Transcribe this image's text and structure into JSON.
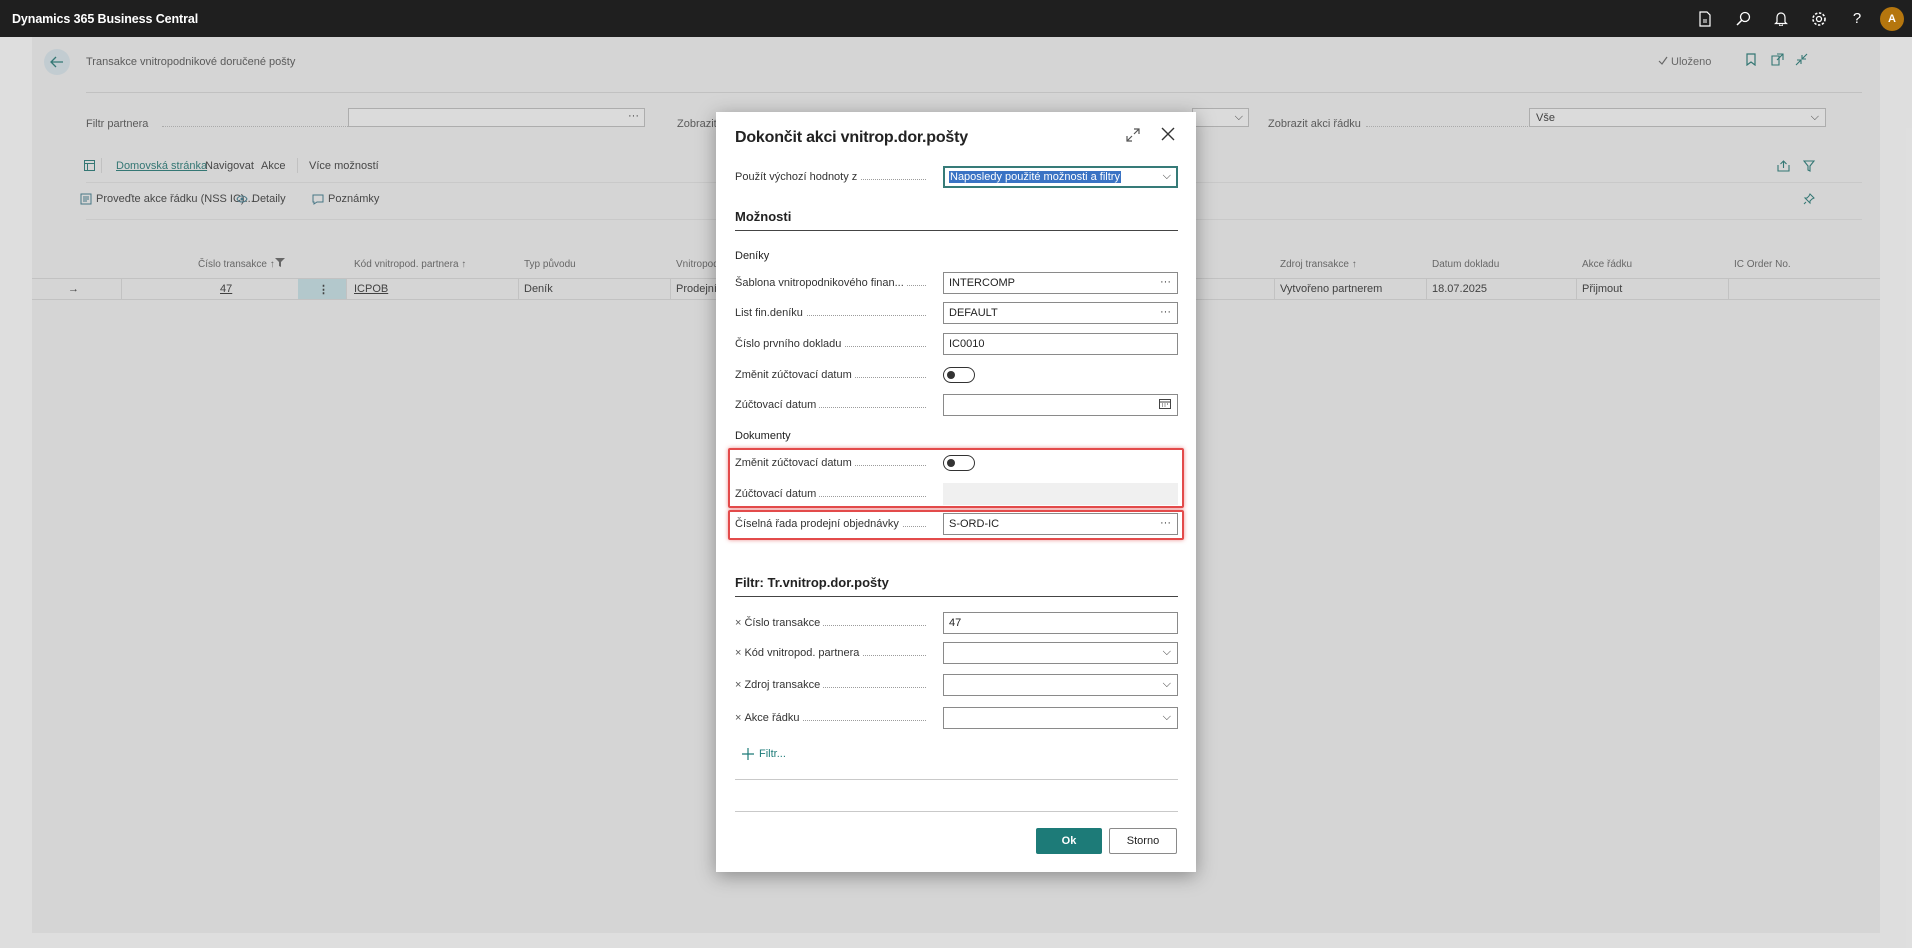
{
  "app": {
    "title": "Dynamics 365 Business Central",
    "avatar_initial": "A"
  },
  "page": {
    "title": "Transakce vnitropodnikové doručené pošty",
    "saved": "Uloženo",
    "filters": {
      "partner_label": "Filtr partnera",
      "show_label": "Zobrazit",
      "line_action_label": "Zobrazit akci řádku",
      "line_action_value": "Vše"
    },
    "actions": {
      "tabs": [
        "Domovská stránka",
        "Navigovat",
        "Akce",
        "Více možností"
      ],
      "sub": [
        "Proveďte akce řádku (NSS IC)...",
        "Detaily",
        "Poznámky"
      ]
    },
    "columns": [
      "Číslo transakce ↑",
      "Kód vnitropod. partnera ↑",
      "Typ původu",
      "Vnitropod",
      "Zdroj transakce ↑",
      "Datum dokladu",
      "Akce řádku",
      "IC Order No."
    ],
    "row": {
      "transaction_no": "47",
      "partner_code": "ICPOB",
      "origin_type": "Deník",
      "ic_direction": "Prodejní",
      "source": "Vytvořeno partnerem",
      "doc_date": "18.07.2025",
      "line_action": "Přijmout"
    }
  },
  "dialog": {
    "title": "Dokončit akci vnitrop.dor.pošty",
    "defaults_label": "Použít výchozí hodnoty z",
    "defaults_value": "Naposledy použité možnosti a filtry",
    "options_heading": "Možnosti",
    "journals": {
      "heading": "Deníky",
      "template_label": "Šablona vnitropodnikového finan...",
      "template_value": "INTERCOMP",
      "batch_label": "List fin.deníku",
      "batch_value": "DEFAULT",
      "first_doc_label": "Číslo prvního dokladu",
      "first_doc_value": "IC0010",
      "replace_date_label": "Změnit zúčtovací datum",
      "posting_date_label": "Zúčtovací datum",
      "posting_date_value": ""
    },
    "documents": {
      "heading": "Dokumenty",
      "replace_date_label": "Změnit zúčtovací datum",
      "posting_date_label": "Zúčtovací datum",
      "posting_date_value": "",
      "sales_nos_label": "Číselná řada prodejní objednávky",
      "sales_nos_value": "S-ORD-IC"
    },
    "filter_heading": "Filtr: Tr.vnitrop.dor.pošty",
    "filters": [
      {
        "label": "Číslo transakce",
        "value": "47"
      },
      {
        "label": "Kód vnitropod. partnera",
        "value": ""
      },
      {
        "label": "Zdroj transakce",
        "value": ""
      },
      {
        "label": "Akce řádku",
        "value": ""
      }
    ],
    "add_filter": "Filtr...",
    "ok": "Ok",
    "cancel": "Storno"
  },
  "colors": {
    "accent": "#1d7b78",
    "highlight": "#e34b4b",
    "topbar": "#1f1f1f"
  }
}
